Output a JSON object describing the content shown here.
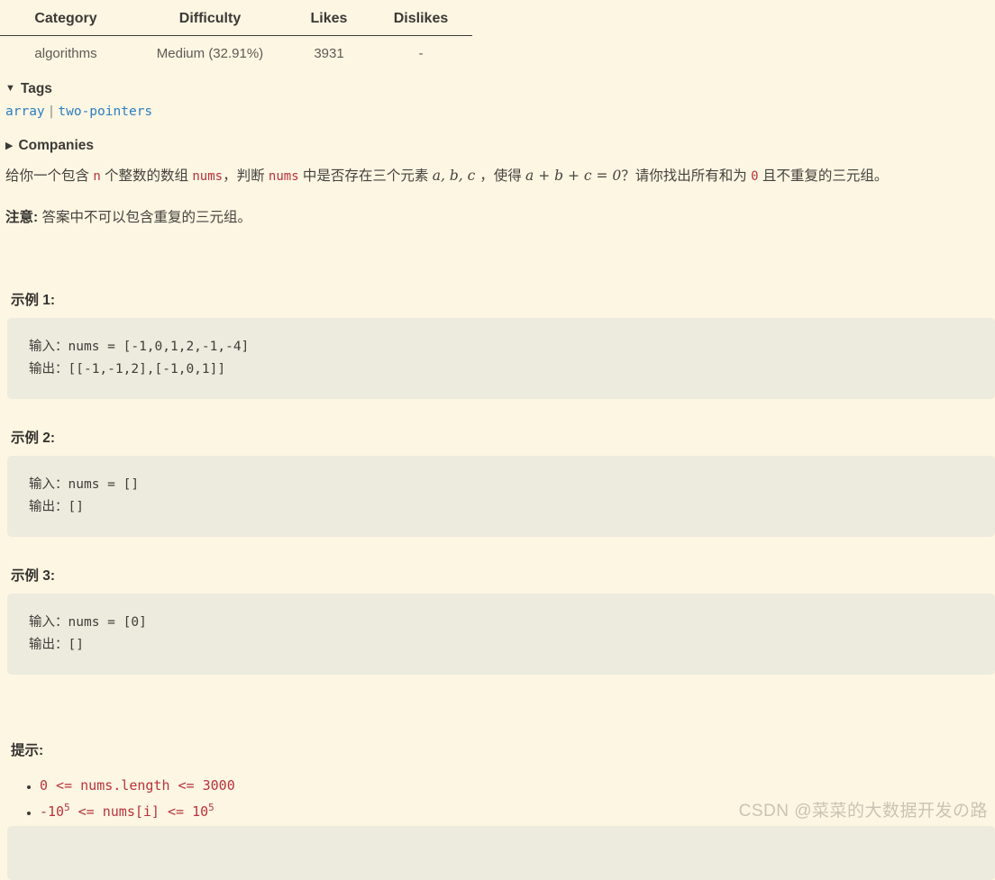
{
  "meta_table": {
    "headers": [
      "Category",
      "Difficulty",
      "Likes",
      "Dislikes"
    ],
    "row": {
      "category": "algorithms",
      "difficulty": "Medium (32.91%)",
      "likes": "3931",
      "dislikes": "-"
    }
  },
  "sections": {
    "tags": {
      "label": "Tags",
      "triangle": "▼",
      "expanded": true,
      "items": [
        "array",
        "two-pointers"
      ],
      "separator": "|"
    },
    "companies": {
      "label": "Companies",
      "triangle": "▶",
      "expanded": false
    }
  },
  "description": {
    "part1": "给你一个包含 ",
    "code_n": "n",
    "part2": " 个整数的数组 ",
    "code_nums1": "nums",
    "part3": "，判断 ",
    "code_nums2": "nums",
    "part4": " 中是否存在三个元素 ",
    "var_abc": "a, b, c ",
    "part5": "，使得 ",
    "var_sum": "a + b + c = 0",
    "part6": "？请你找出所有和为 ",
    "code_zero": "0",
    "part7": " 且不重复的三元组。",
    "note_label": "注意:",
    "note_text": " 答案中不可以包含重复的三元组。"
  },
  "examples": [
    {
      "title": "示例 1:",
      "code": "输入：nums = [-1,0,1,2,-1,-4]\n输出：[[-1,-1,2],[-1,0,1]]"
    },
    {
      "title": "示例 2:",
      "code": "输入：nums = []\n输出：[]"
    },
    {
      "title": "示例 3:",
      "code": "输入：nums = [0]\n输出：[]"
    }
  ],
  "hints": {
    "title": "提示:",
    "items": [
      {
        "pre": "0 <= nums.length <= 3000",
        "sup": "",
        "post": ""
      },
      {
        "pre": "-10",
        "sup": "5",
        "post": " <= nums[i] <= 10",
        "sup2": "5"
      }
    ]
  },
  "watermark": "CSDN @菜菜的大数据开发の路",
  "colors": {
    "page_background": "#fdf6e3",
    "code_background": "#edeade",
    "link_blue": "#2a7fc0",
    "inline_code_red": "#b8333b",
    "heading_text": "#3b3a36",
    "body_text": "#45433d",
    "watermark_gray": "#c9c4b3"
  }
}
